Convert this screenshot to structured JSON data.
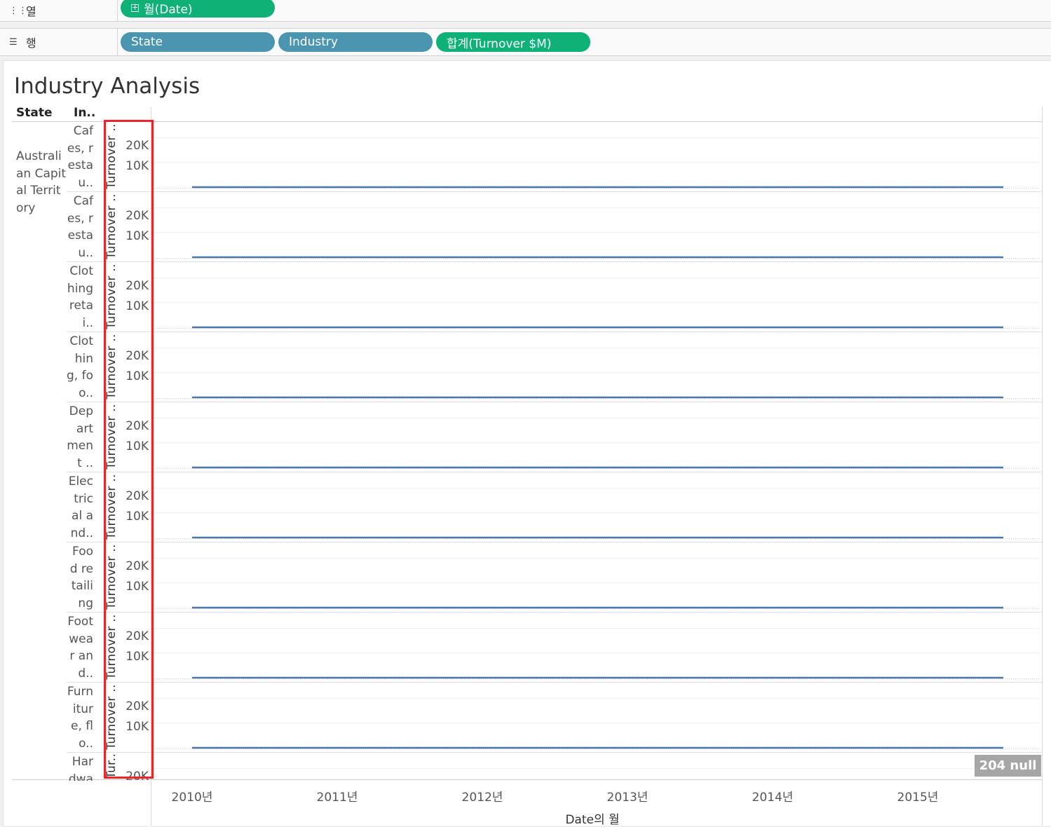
{
  "shelves": {
    "columns": {
      "icon": "columns-icon",
      "label": "열",
      "pills": [
        {
          "text": "월(Date)",
          "color": "#0fb177",
          "has_plus": true
        }
      ]
    },
    "rows": {
      "icon": "rows-icon",
      "label": "행",
      "pills": [
        {
          "text": "State",
          "color": "#4b95b1"
        },
        {
          "text": "Industry",
          "color": "#4b95b1"
        },
        {
          "text": "합계(Turnover $M)",
          "color": "#0fb177"
        }
      ]
    }
  },
  "view": {
    "title": "Industry Analysis",
    "headers": {
      "state": "State",
      "industry": "In.."
    },
    "state_value": "Australian Capital Territory",
    "panes": [
      {
        "industry": "Cafes, restau..",
        "axis_title": "Turnover ..",
        "ticks": [
          "20K",
          "10K"
        ]
      },
      {
        "industry": "Cafes, restau..",
        "axis_title": "Turnover ..",
        "ticks": [
          "20K",
          "10K"
        ]
      },
      {
        "industry": "Clothing retai..",
        "axis_title": "Turnover ..",
        "ticks": [
          "20K",
          "10K"
        ]
      },
      {
        "industry": "Clothing, foo..",
        "axis_title": "Turnover ..",
        "ticks": [
          "20K",
          "10K"
        ]
      },
      {
        "industry": "Department ..",
        "axis_title": "Turnover ..",
        "ticks": [
          "20K",
          "10K"
        ]
      },
      {
        "industry": "Electrical and..",
        "axis_title": "Turnover ..",
        "ticks": [
          "20K",
          "10K"
        ]
      },
      {
        "industry": "Food retailing",
        "axis_title": "Turnover ..",
        "ticks": [
          "20K",
          "10K"
        ]
      },
      {
        "industry": "Footwear and..",
        "axis_title": "Turnover ..",
        "ticks": [
          "20K",
          "10K"
        ]
      },
      {
        "industry": "Furniture, flo..",
        "axis_title": "Turnover ..",
        "ticks": [
          "20K",
          "10K"
        ]
      },
      {
        "industry": "Hardware..",
        "axis_title": "Tur..",
        "ticks": [
          "20K"
        ]
      }
    ],
    "x_axis": {
      "title": "Date의 월",
      "years": [
        "2010년",
        "2011년",
        "2012년",
        "2013년",
        "2014년",
        "2015년"
      ]
    },
    "null_badge": "204 null"
  },
  "chart_data": {
    "type": "line",
    "title": "Industry Analysis",
    "xlabel": "Date의 월",
    "ylabel": "Turnover ..",
    "x": [
      "2010년",
      "2011년",
      "2012년",
      "2013년",
      "2014년",
      "2015년"
    ],
    "ylim": [
      0,
      25000
    ],
    "series_color": "#4e79a7",
    "series": [
      {
        "values": [
          0,
          0,
          0,
          0,
          0,
          0
        ]
      },
      {
        "values": [
          0,
          0,
          0,
          0,
          0,
          0
        ]
      },
      {
        "values": [
          0,
          0,
          0,
          0,
          0,
          0
        ]
      },
      {
        "values": [
          0,
          0,
          0,
          0,
          0,
          0
        ]
      },
      {
        "values": [
          0,
          0,
          0,
          0,
          0,
          0
        ]
      },
      {
        "values": [
          0,
          0,
          0,
          0,
          0,
          0
        ]
      },
      {
        "values": [
          0,
          0,
          0,
          0,
          0,
          0
        ]
      },
      {
        "values": [
          0,
          0,
          0,
          0,
          0,
          0
        ]
      },
      {
        "values": [
          0,
          0,
          0,
          0,
          0,
          0
        ]
      }
    ],
    "grid": true
  }
}
